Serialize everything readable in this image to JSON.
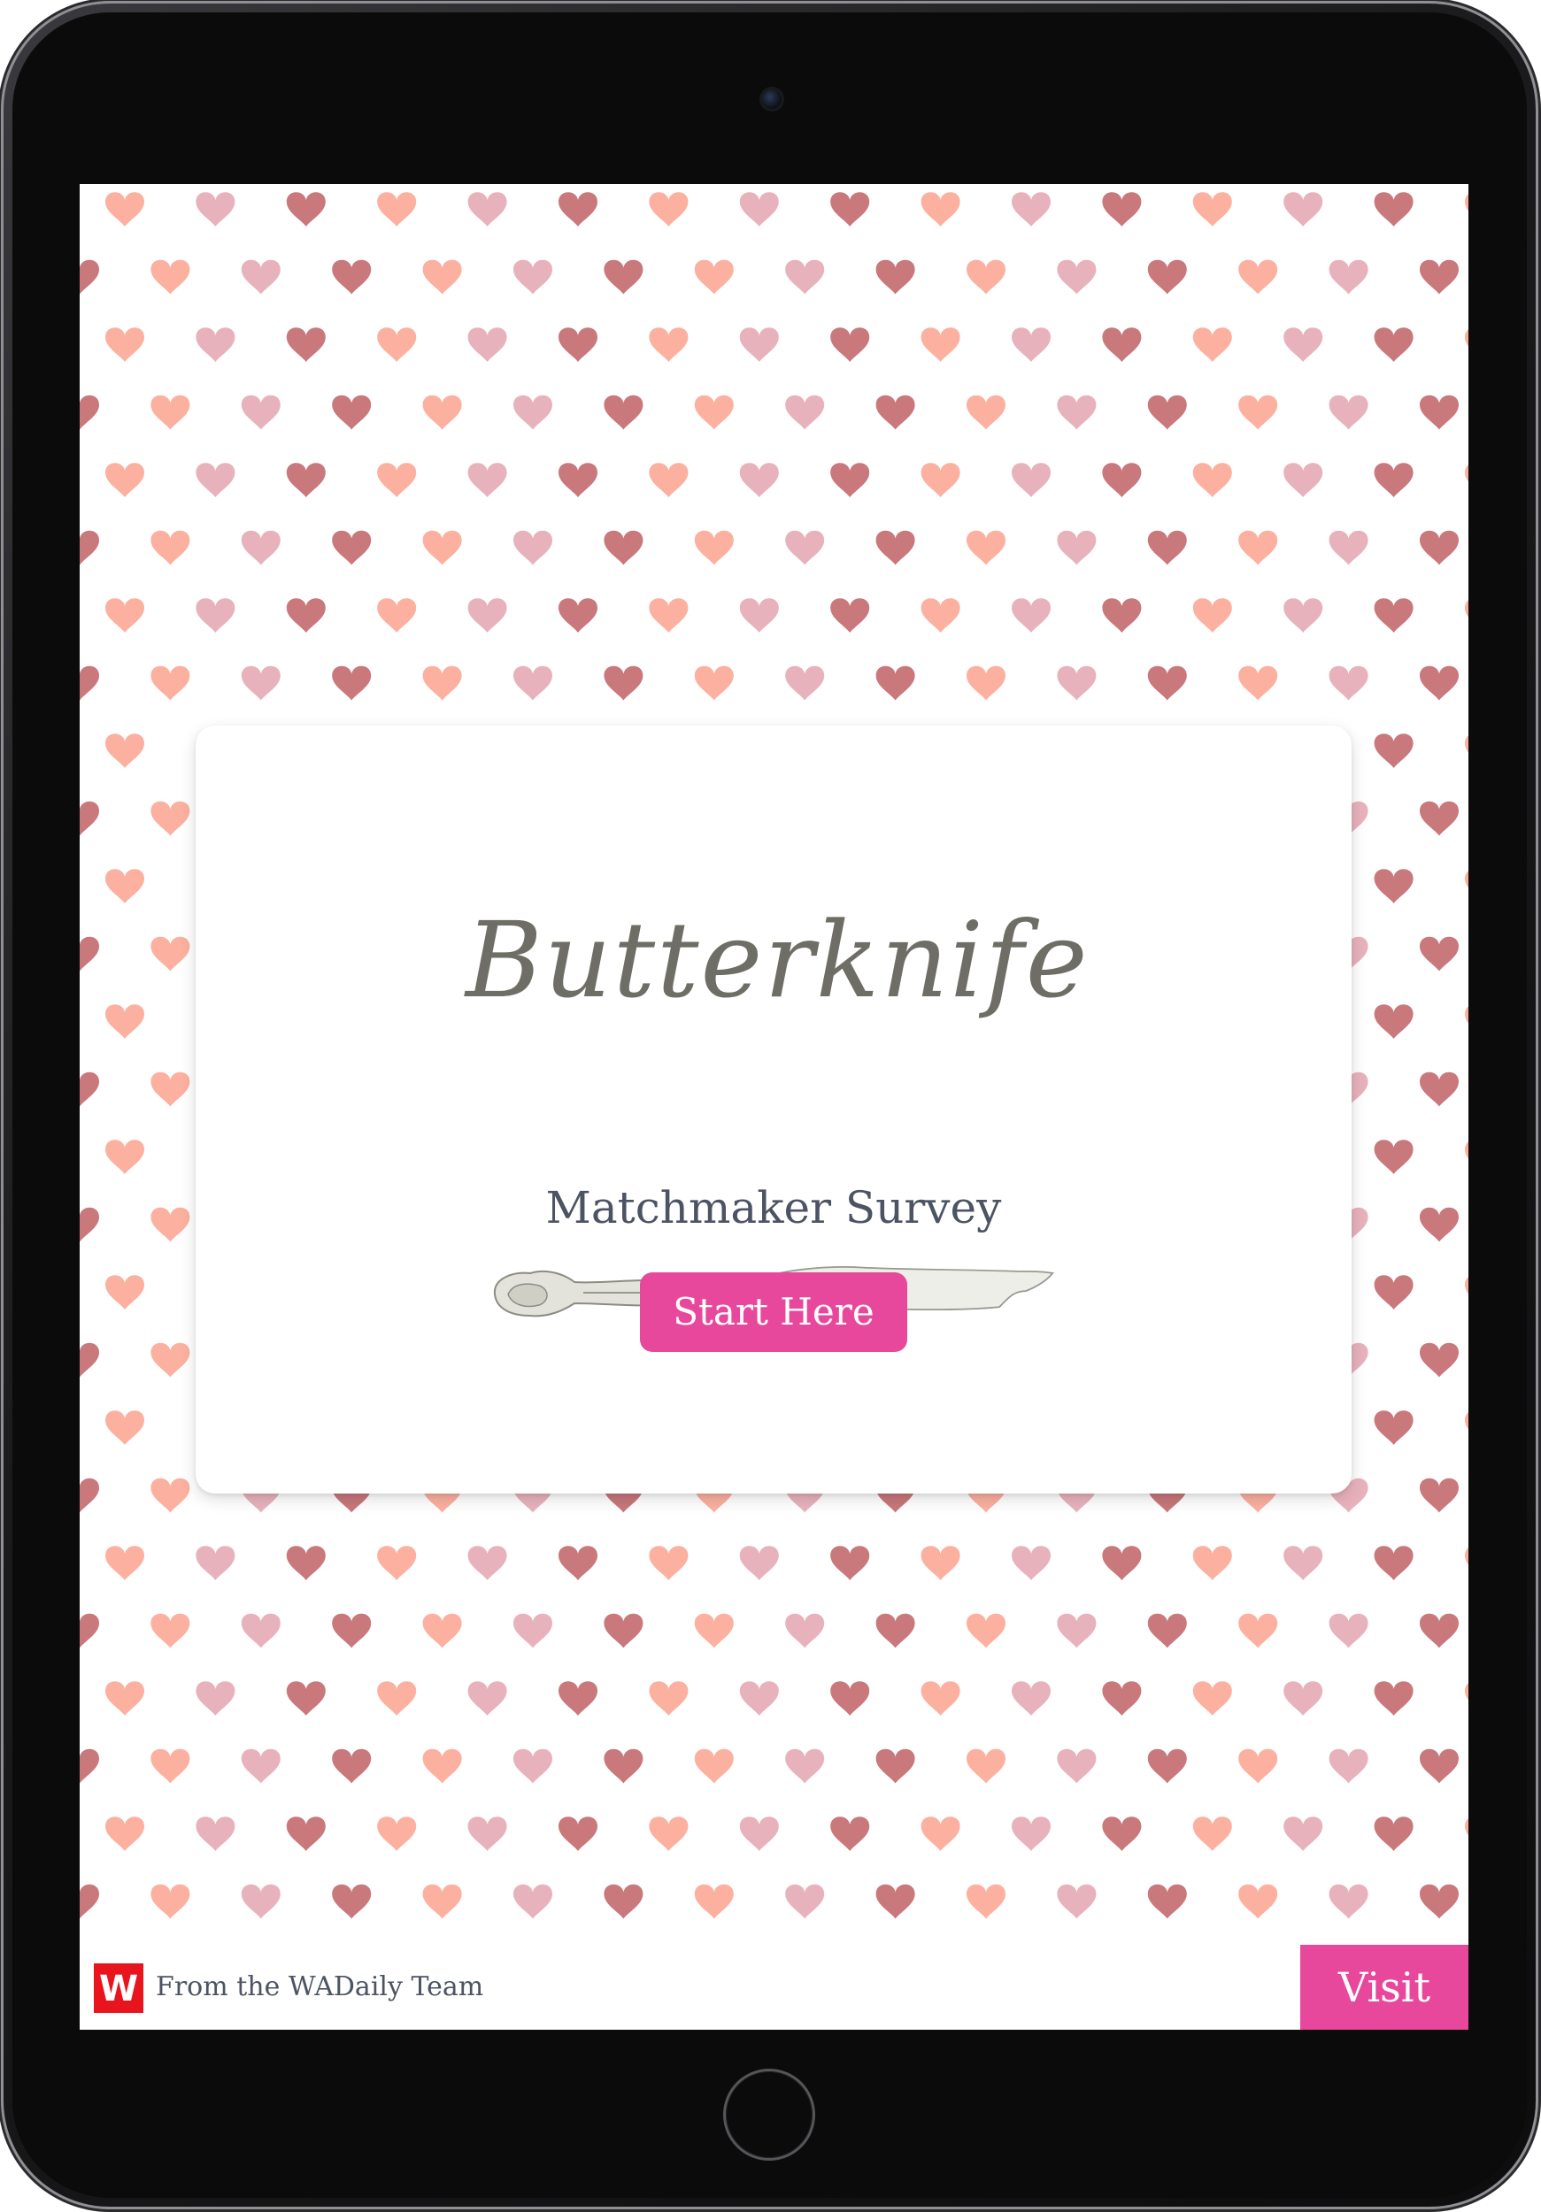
{
  "colors": {
    "accent": "#e8489c",
    "brand_red": "#e8141e",
    "heart_dark": "#c9787c",
    "heart_pink": "#e8b2bd",
    "heart_peach": "#fcb0a0",
    "text": "#4c5363"
  },
  "card": {
    "logo_text": "Butterknife",
    "title": "Matchmaker Survey",
    "start_label": "Start Here"
  },
  "footer": {
    "logo_letter": "W",
    "from_text": "From the WADaily Team",
    "visit_label": "Visit"
  },
  "icons": {
    "background": "heart-icon",
    "logo_knife": "butter-knife-icon"
  }
}
